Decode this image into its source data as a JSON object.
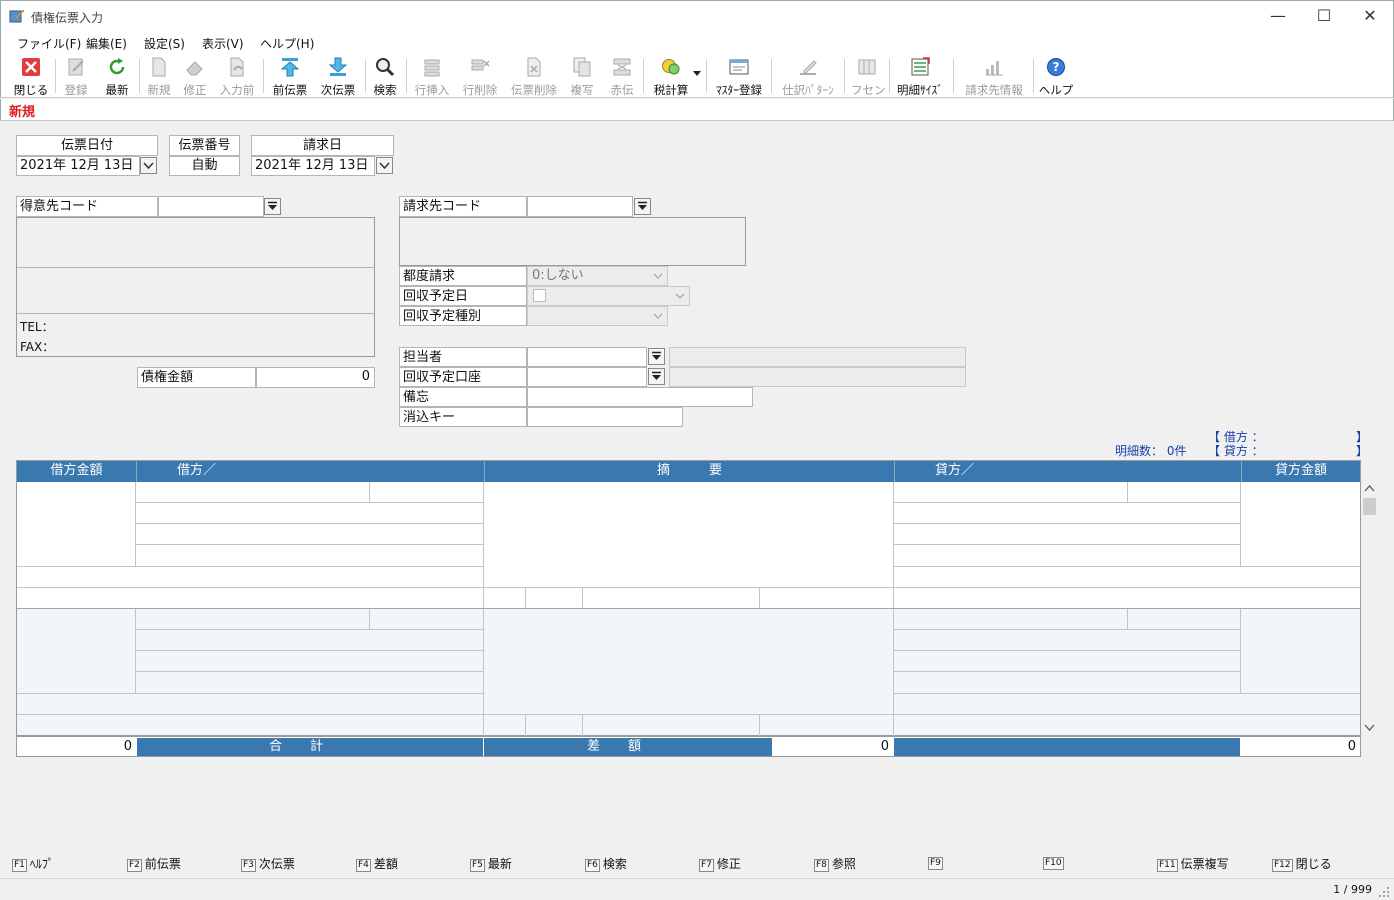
{
  "window": {
    "title": "債権伝票入力",
    "minimize": "—",
    "maximize": "☐",
    "close": "✕"
  },
  "menu": [
    "ファイル(F)",
    "編集(E)",
    "設定(S)",
    "表示(V)",
    "ヘルプ(H)"
  ],
  "toolbar": {
    "close": "閉じる",
    "register": "登録",
    "refresh": "最新",
    "new": "新規",
    "modify": "修正",
    "before_input": "入力前",
    "prev_slip": "前伝票",
    "next_slip": "次伝票",
    "search": "検索",
    "row_insert": "行挿入",
    "row_delete": "行削除",
    "slip_delete": "伝票削除",
    "copy": "複写",
    "red_slip": "赤伝",
    "tax_calc": "税計算",
    "master": "ﾏｽﾀｰ登録",
    "journal_pattern": "仕訳ﾊﾟﾀｰﾝ",
    "sticky": "フセン",
    "detail_size": "明細ｻｲｽﾞ",
    "billing_info": "請求先情報",
    "help": "ヘルプ"
  },
  "mode": "新規",
  "header": {
    "slip_date_label": "伝票日付",
    "slip_date_value": "2021年 12月 13日",
    "slip_no_label": "伝票番号",
    "slip_no_value": "自動",
    "bill_date_label": "請求日",
    "bill_date_value": "2021年 12月 13日"
  },
  "customer": {
    "code_label": "得意先コード",
    "code_value": "",
    "tel_label": "TEL：",
    "fax_label": "FAX："
  },
  "amount": {
    "label": "債権金額",
    "value": "0"
  },
  "billing": {
    "code_label": "請求先コード",
    "code_value": "",
    "each_bill_label": "都度請求",
    "each_bill_value": "0:しない",
    "collect_date_label": "回収予定日",
    "collect_type_label": "回収予定種別",
    "staff_label": "担当者",
    "account_label": "回収予定口座",
    "memo_label": "備忘",
    "key_label": "消込キー"
  },
  "detail_info": {
    "count_label": "明細数：",
    "count_value": "0件",
    "debit_label": "【 借方 ：",
    "credit_label": "【 貸方 ：",
    "bracket_close": "】"
  },
  "grid": {
    "headers": {
      "debit_amount": "借方金額",
      "debit": "借方／",
      "summary": "摘　　　要",
      "credit": "貸方／",
      "credit_amount": "貸方金額"
    }
  },
  "totals": {
    "debit_total": "0",
    "total_label": "合計",
    "diff_label": "差額",
    "diff_value": "0",
    "credit_total": "0"
  },
  "fkeys": [
    {
      "key": "F1",
      "label": "ﾍﾙﾌﾟ"
    },
    {
      "key": "F2",
      "label": "前伝票"
    },
    {
      "key": "F3",
      "label": "次伝票"
    },
    {
      "key": "F4",
      "label": "差額"
    },
    {
      "key": "F5",
      "label": "最新"
    },
    {
      "key": "F6",
      "label": "検索"
    },
    {
      "key": "F7",
      "label": "修正"
    },
    {
      "key": "F8",
      "label": "参照"
    },
    {
      "key": "F9",
      "label": ""
    },
    {
      "key": "F10",
      "label": ""
    },
    {
      "key": "F11",
      "label": "伝票複写"
    },
    {
      "key": "F12",
      "label": "閉じる"
    }
  ],
  "status": {
    "page": "1 / 999"
  },
  "colors": {
    "accent": "#3a78b0",
    "mode": "#e02020",
    "info_text": "#1a3fa8"
  }
}
